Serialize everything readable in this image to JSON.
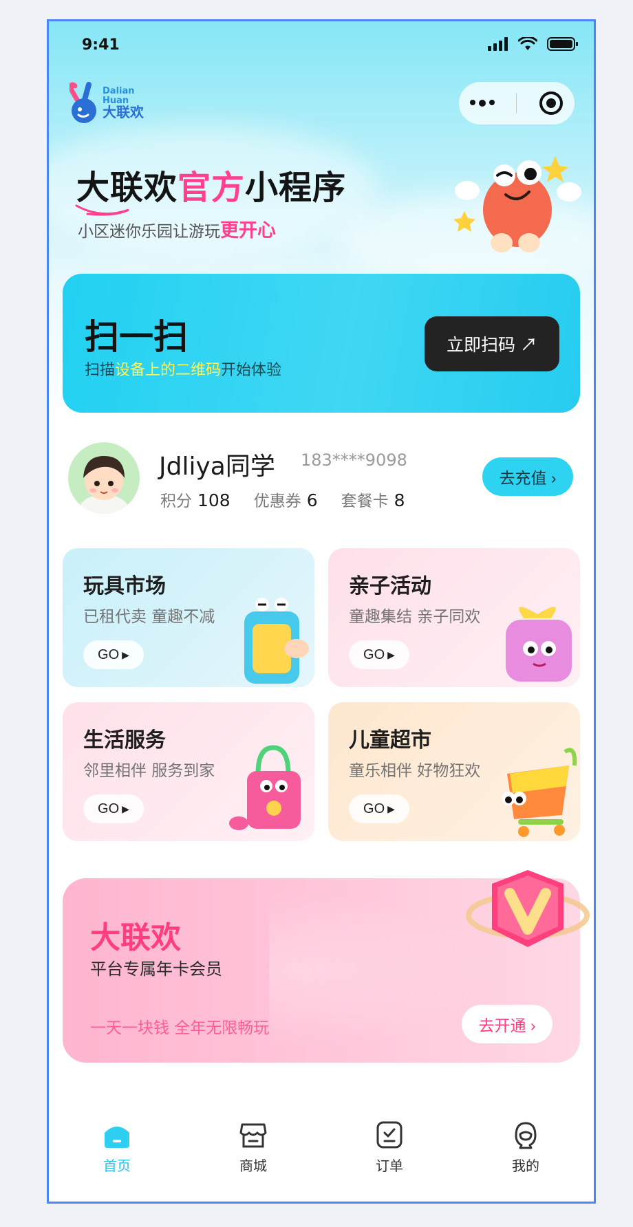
{
  "status_bar": {
    "time": "9:41"
  },
  "logo": {
    "en_line1": "Dalian",
    "en_line2": "Huan",
    "cn": "大联欢"
  },
  "headline": {
    "part1": "大联欢",
    "part2": "官方",
    "part3": "小程序"
  },
  "subline": {
    "text": "小区迷你乐园让游玩",
    "highlight": "更开心"
  },
  "scan": {
    "title": "扫一扫",
    "sub_prefix": "扫描",
    "sub_highlight": "设备上的二维码",
    "sub_suffix": "开始体验",
    "button": "立即扫码 ↗"
  },
  "user": {
    "name": "Jdliya同学",
    "phone": "183****9098",
    "points_label": "积分",
    "points": "108",
    "coupons_label": "优惠券",
    "coupons": "6",
    "cards_label": "套餐卡",
    "cards": "8",
    "recharge": "去充值 ›"
  },
  "features": [
    {
      "title": "玩具市场",
      "sub": "已租代卖 童趣不减",
      "go": "GO"
    },
    {
      "title": "亲子活动",
      "sub": "童趣集结 亲子同欢",
      "go": "GO"
    },
    {
      "title": "生活服务",
      "sub": "邻里相伴 服务到家",
      "go": "GO"
    },
    {
      "title": "儿童超市",
      "sub": "童乐相伴 好物狂欢",
      "go": "GO"
    }
  ],
  "vip": {
    "title": "大联欢",
    "sub": "平台专属年卡会员",
    "slogan": "一天一块钱 全年无限畅玩",
    "button": "去开通 ›"
  },
  "tabs": [
    {
      "label": "首页",
      "icon": "home-icon",
      "active": true
    },
    {
      "label": "商城",
      "icon": "shop-icon",
      "active": false
    },
    {
      "label": "订单",
      "icon": "order-icon",
      "active": false
    },
    {
      "label": "我的",
      "icon": "profile-icon",
      "active": false
    }
  ],
  "colors": {
    "accent": "#2fd3f2",
    "pink": "#ff3f8f",
    "dark": "#232323"
  }
}
